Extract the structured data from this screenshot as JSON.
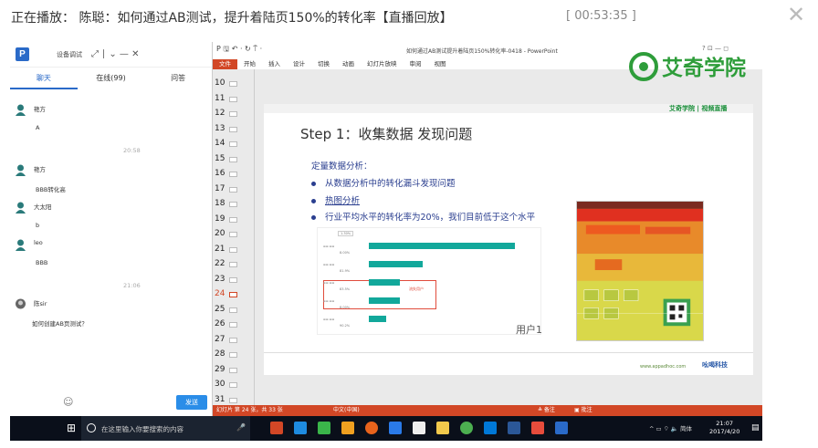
{
  "header": {
    "title": "正在播放： 陈聪：如何通过AB测试，提升着陆页150%的转化率【直播回放】",
    "time": "[ 00:53:35 ]",
    "close_icon": "close-icon"
  },
  "chat": {
    "logo": "P",
    "title": "设备调试",
    "controls": "⤢ ∣ ⌄ — ✕",
    "tabs": [
      "聊天",
      "在线(99)",
      "问答"
    ],
    "messages": [
      {
        "name": "艳方",
        "text": "A"
      },
      {
        "name": "艳方",
        "text": "BBB转化高"
      },
      {
        "name": "大太阳",
        "text": "b"
      },
      {
        "name": "leo",
        "text": "BBB"
      },
      {
        "name": "陈sir",
        "text": "如何创建AB页测试？"
      }
    ],
    "timestamps": [
      "20:58",
      "21:06"
    ],
    "send": "发送"
  },
  "ppt": {
    "quick_access": "P  🖫  ↶ · ↻  ⍑ ·",
    "window_title": "如何通过AB测试提升着陆页150%转化率-0418 - PowerPoint",
    "window_controls": "?  ⊡  —  ◻",
    "ribbon_tabs": [
      "文件",
      "开始",
      "插入",
      "设计",
      "切换",
      "动画",
      "幻灯片放映",
      "审阅",
      "视图"
    ],
    "thumbs": [
      "10",
      "11",
      "12",
      "13",
      "14",
      "15",
      "16",
      "17",
      "18",
      "19",
      "20",
      "21",
      "22",
      "23",
      "24",
      "25",
      "26",
      "27",
      "28",
      "29",
      "30",
      "31"
    ],
    "selected_slide": "24",
    "slide": {
      "logos": "艾奇学院 | 视频直播",
      "title": "Step 1：收集数据   发现问题",
      "subtitle": "定量数据分析：",
      "bullets": [
        "从数据分析中的转化漏斗发现问题",
        "热图分析",
        "行业平均水平的转化率为20%，我们目前低于这个水平"
      ],
      "funnel": {
        "header": "1.30%",
        "pcts": [
          "8.00%",
          "81.9%",
          "83.5%",
          "8.00%",
          "90.2%"
        ],
        "values": [
          1.0,
          0.37,
          0.21,
          0.21,
          0.12
        ],
        "note": "流失用户"
      },
      "user_label": "用户1",
      "url": "www.appadhoc.com",
      "corp": "吆喝科技"
    },
    "status": {
      "slide_info": "幻灯片 第 24 张，共 33 张",
      "lang": "中文(中国)",
      "notes": "≜ 备注",
      "comments": "▣ 批注"
    },
    "brand": "艾奇学院"
  },
  "taskbar": {
    "start": "⊞",
    "search_placeholder": "在这里输入你要搜索的内容",
    "mic": "🎤",
    "tray": "^ ▭ ⌔ 🔈 简体",
    "time": "21:07",
    "date": "2017/4/20",
    "notification": "▤"
  },
  "colors": {
    "ppt_accent": "#d24726",
    "chat_blue": "#2a6ac8",
    "funnel_bar": "#12a89b",
    "brand_green": "#2e9d3a"
  }
}
